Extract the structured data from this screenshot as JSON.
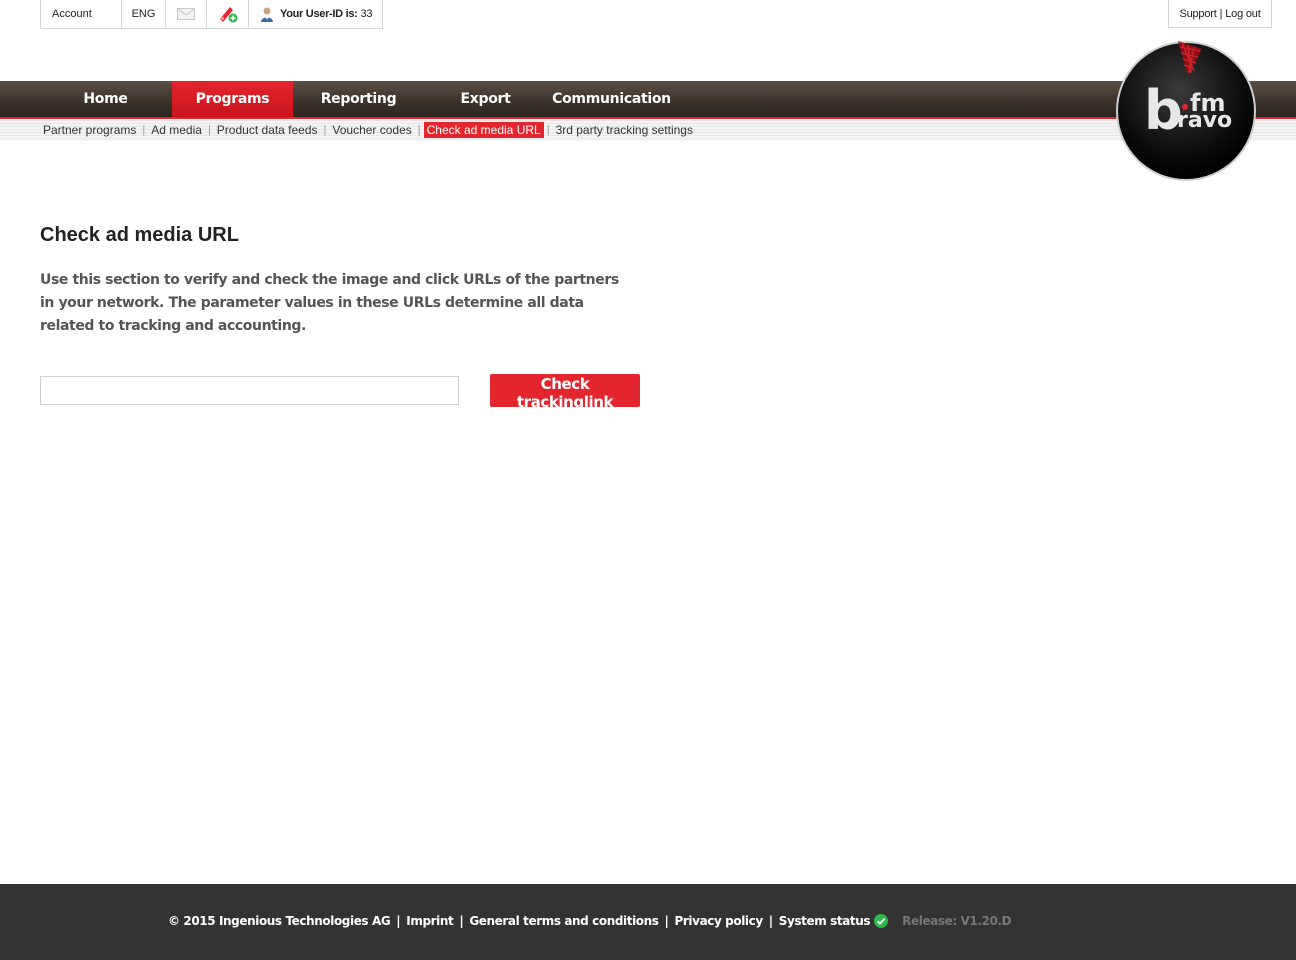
{
  "topbar": {
    "account": "Account",
    "language": "ENG",
    "mail_icon": "mail-icon",
    "add_icon": "add-tag-icon",
    "user_label": "Your User-ID is:",
    "user_id": "33"
  },
  "support": {
    "support_label": "Support",
    "separator": "|",
    "logout_label": "Log out"
  },
  "logo": {
    "brand": "bravo.fm",
    "letter_b": "b",
    "fm": "fm",
    "ravo": "ravo"
  },
  "nav": {
    "items": [
      {
        "label": "Home"
      },
      {
        "label": "Programs",
        "active": true
      },
      {
        "label": "Reporting"
      },
      {
        "label": "Export"
      },
      {
        "label": "Communication"
      }
    ]
  },
  "subnav": {
    "items": [
      {
        "label": "Partner programs"
      },
      {
        "label": "Ad media"
      },
      {
        "label": "Product data feeds"
      },
      {
        "label": "Voucher codes"
      },
      {
        "label": "Check ad media URL",
        "active": true
      },
      {
        "label": "3rd party tracking settings"
      }
    ]
  },
  "main": {
    "title": "Check ad media URL",
    "description": "Use this section to verify and check the image and click URLs of the partners in your network. The parameter values in these URLs determine all data related to tracking and accounting.",
    "url_value": "",
    "button_label": "Check trackinglink"
  },
  "footer": {
    "copyright": "© 2015 Ingenious Technologies AG",
    "sep": "|",
    "imprint": "Imprint",
    "terms": "General terms and conditions",
    "privacy": "Privacy policy",
    "system_status": "System status",
    "status_icon": "check-circle-icon",
    "release": "Release: V1.20.D"
  },
  "colors": {
    "accent_red": "#e3262d",
    "nav_brown": "#3e332b",
    "footer_bg": "#333333",
    "status_green": "#2db84a"
  }
}
